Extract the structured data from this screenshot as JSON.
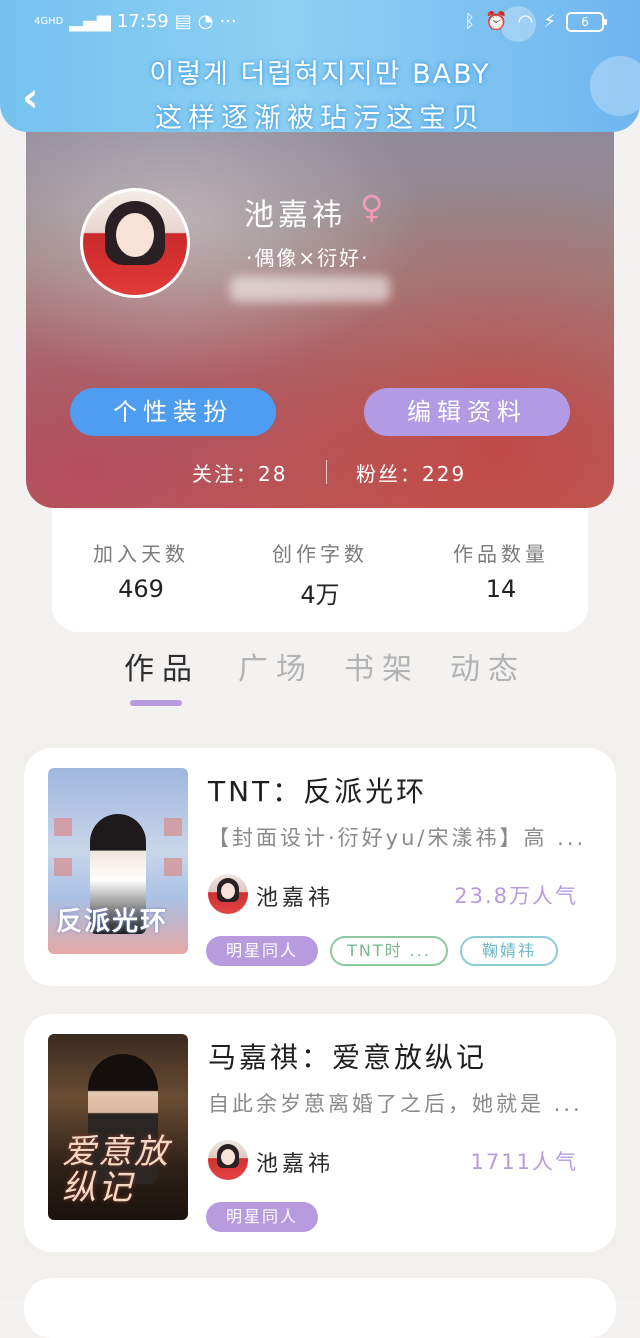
{
  "status_bar": {
    "network": "4GHD",
    "time": "17:59",
    "battery": "6"
  },
  "lyrics": {
    "line1": "이렇게 더럽혀지지만 BABY",
    "line2": "这样逐渐被玷污这宝贝"
  },
  "profile": {
    "name": "池嘉祎",
    "gender_symbol": "♀",
    "tagline": "·偶像×衍好·",
    "buttons": {
      "outfit": "个性装扮",
      "edit": "编辑资料"
    },
    "follows_label": "关注：28",
    "fans_label": "粉丝：229"
  },
  "stats": [
    {
      "label": "加入天数",
      "value": "469"
    },
    {
      "label": "创作字数",
      "value": "4万"
    },
    {
      "label": "作品数量",
      "value": "14"
    }
  ],
  "tabs": [
    "作品",
    "广场",
    "书架",
    "动态"
  ],
  "works": [
    {
      "title": "TNT：反派光环",
      "desc": "【封面设计·衍好yu/宋漾祎】高 ...",
      "author": "池嘉祎",
      "popularity": "23.8万人气",
      "cover_text": "反派光环",
      "tags": [
        "明星同人",
        "TNT时 ...",
        "鞠婧祎"
      ]
    },
    {
      "title": "马嘉祺：爱意放纵记",
      "desc": "自此余岁葸离婚了之后，她就是 ...",
      "author": "池嘉祎",
      "popularity": "1711人气",
      "cover_text": "爱意放纵记",
      "tags": [
        "明星同人"
      ]
    }
  ]
}
